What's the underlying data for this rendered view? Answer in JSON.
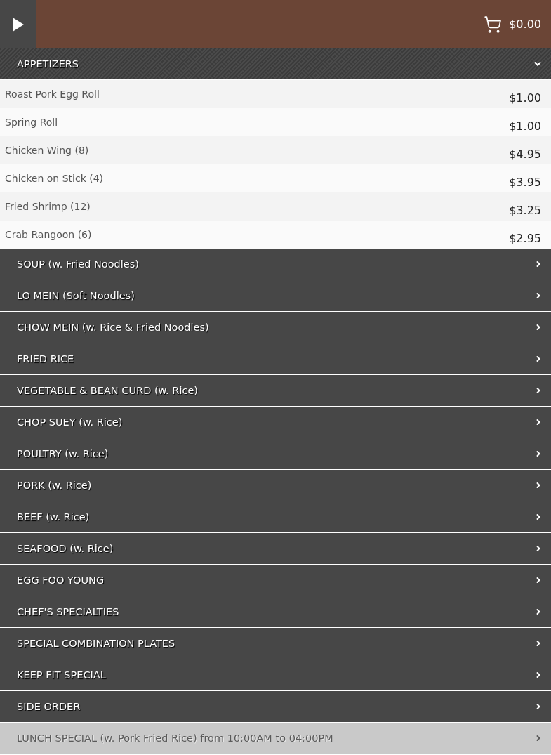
{
  "header": {
    "cart_total": "$0.00"
  },
  "categories": [
    {
      "label": "APPETIZERS",
      "expanded": true,
      "disabled": false,
      "items": [
        {
          "name": "Roast Pork Egg Roll",
          "price": "$1.00"
        },
        {
          "name": "Spring Roll",
          "price": "$1.00"
        },
        {
          "name": "Chicken Wing (8)",
          "price": "$4.95"
        },
        {
          "name": "Chicken on Stick (4)",
          "price": "$3.95"
        },
        {
          "name": "Fried Shrimp (12)",
          "price": "$3.25"
        },
        {
          "name": "Crab Rangoon (6)",
          "price": "$2.95"
        }
      ]
    },
    {
      "label": "SOUP (w. Fried Noodles)",
      "expanded": false,
      "disabled": false
    },
    {
      "label": "LO MEIN (Soft Noodles)",
      "expanded": false,
      "disabled": false
    },
    {
      "label": "CHOW MEIN (w. Rice & Fried Noodles)",
      "expanded": false,
      "disabled": false
    },
    {
      "label": "FRIED RICE",
      "expanded": false,
      "disabled": false
    },
    {
      "label": "VEGETABLE & BEAN CURD (w. Rice)",
      "expanded": false,
      "disabled": false
    },
    {
      "label": "CHOP SUEY (w. Rice)",
      "expanded": false,
      "disabled": false
    },
    {
      "label": "POULTRY (w. Rice)",
      "expanded": false,
      "disabled": false
    },
    {
      "label": "PORK (w. Rice)",
      "expanded": false,
      "disabled": false
    },
    {
      "label": "BEEF (w. Rice)",
      "expanded": false,
      "disabled": false
    },
    {
      "label": "SEAFOOD (w. Rice)",
      "expanded": false,
      "disabled": false
    },
    {
      "label": "EGG FOO YOUNG",
      "expanded": false,
      "disabled": false
    },
    {
      "label": "CHEF'S SPECIALTIES",
      "expanded": false,
      "disabled": false
    },
    {
      "label": "SPECIAL COMBINATION PLATES",
      "expanded": false,
      "disabled": false
    },
    {
      "label": "KEEP FIT SPECIAL",
      "expanded": false,
      "disabled": false
    },
    {
      "label": "SIDE ORDER",
      "expanded": false,
      "disabled": false
    },
    {
      "label": "LUNCH SPECIAL (w. Pork Fried Rice) from 10:00AM to 04:00PM",
      "expanded": false,
      "disabled": true
    }
  ]
}
